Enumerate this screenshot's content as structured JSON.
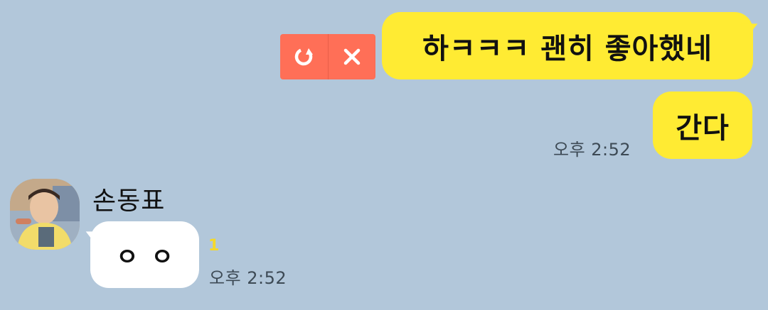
{
  "chat": {
    "outgoing": [
      {
        "text": "하ㅋㅋㅋ 괜히 좋아했네",
        "status": "failed"
      },
      {
        "text": "간다",
        "time": "오후 2:52"
      }
    ],
    "failed_actions": {
      "retry_icon": "retry-icon",
      "delete_icon": "close-icon"
    },
    "incoming": {
      "sender_name": "손동표",
      "text": "ㅇㅇ",
      "unread_count": "1",
      "time": "오후 2:52"
    }
  },
  "colors": {
    "background": "#b2c7da",
    "outgoing_bubble": "#ffeb33",
    "incoming_bubble": "#ffffff",
    "failed_action": "#ff6f57",
    "unread": "#f5d92a"
  }
}
